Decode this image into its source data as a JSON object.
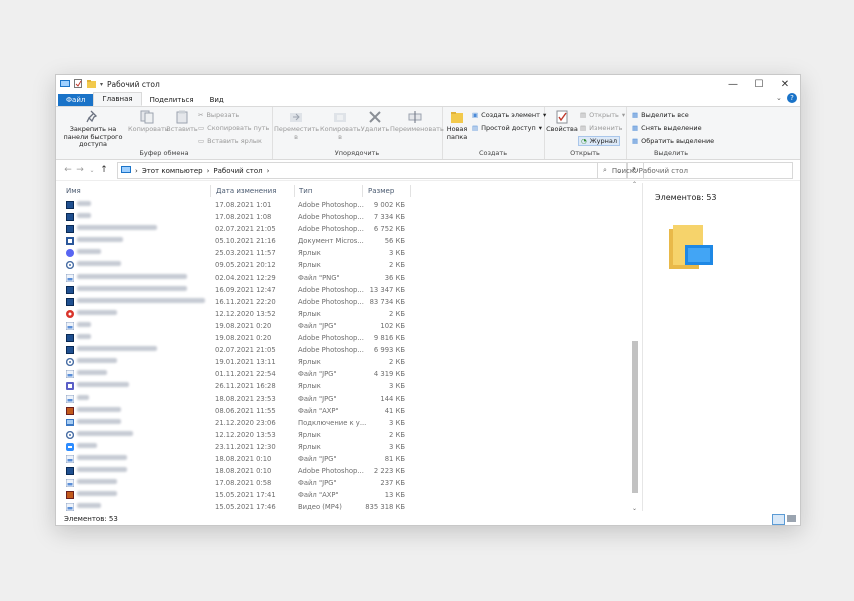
{
  "window": {
    "title": "Рабочий стол",
    "controls": {
      "minimize": "—",
      "maximize": "☐",
      "close": "✕"
    }
  },
  "tabs": [
    "Файл",
    "Главная",
    "Поделиться",
    "Вид"
  ],
  "ribbon": {
    "clipboard": {
      "pin": "Закрепить на панели быстрого доступа",
      "copy": "Копировать",
      "paste": "Вставить",
      "cut": "Вырезать",
      "copy_path": "Скопировать путь",
      "paste_shortcut": "Вставить ярлык",
      "group": "Буфер обмена"
    },
    "organize": {
      "move": "Переместить в",
      "copy_to": "Копировать в",
      "delete": "Удалить",
      "rename": "Переименовать",
      "group": "Упорядочить"
    },
    "new": {
      "folder": "Новая папка",
      "new_item": "Создать элемент",
      "easy_access": "Простой доступ",
      "group": "Создать"
    },
    "open": {
      "properties": "Свойства",
      "open": "Открыть",
      "edit": "Изменить",
      "history": "Журнал",
      "group": "Открыть"
    },
    "select": {
      "select_all": "Выделить все",
      "select_none": "Снять выделение",
      "invert": "Обратить выделение",
      "group": "Выделить"
    }
  },
  "address": {
    "crumbs": [
      "Этот компьютер",
      "Рабочий стол"
    ],
    "search_placeholder": "Поиск: Рабочий стол"
  },
  "columns": {
    "name": "Имя",
    "date": "Дата изменения",
    "type": "Тип",
    "size": "Размер"
  },
  "files": [
    {
      "date": "17.08.2021 1:01",
      "type": "Adobe Photoshop...",
      "size": "9 002 КБ",
      "icon": "ps",
      "w": 14
    },
    {
      "date": "17.08.2021 1:08",
      "type": "Adobe Photoshop...",
      "size": "7 334 КБ",
      "icon": "ps",
      "w": 14
    },
    {
      "date": "02.07.2021 21:05",
      "type": "Adobe Photoshop...",
      "size": "6 752 КБ",
      "icon": "ps",
      "w": 80
    },
    {
      "date": "05.10.2021 21:16",
      "type": "Документ Micros...",
      "size": "56 КБ",
      "icon": "word",
      "w": 46
    },
    {
      "date": "25.03.2021 11:57",
      "type": "Ярлык",
      "size": "3 КБ",
      "icon": "discord",
      "w": 24
    },
    {
      "date": "09.05.2021 20:12",
      "type": "Ярлык",
      "size": "2 КБ",
      "icon": "gear",
      "w": 44
    },
    {
      "date": "02.04.2021 12:29",
      "type": "Файл \"PNG\"",
      "size": "36 КБ",
      "icon": "img",
      "w": 110
    },
    {
      "date": "16.09.2021 12:47",
      "type": "Adobe Photoshop...",
      "size": "13 347 КБ",
      "icon": "ps",
      "w": 110
    },
    {
      "date": "16.11.2021 22:20",
      "type": "Adobe Photoshop...",
      "size": "83 734 КБ",
      "icon": "ps",
      "w": 128
    },
    {
      "date": "12.12.2020 13:52",
      "type": "Ярлык",
      "size": "2 КБ",
      "icon": "red",
      "w": 40
    },
    {
      "date": "19.08.2021 0:20",
      "type": "Файл \"JPG\"",
      "size": "102 КБ",
      "icon": "img",
      "w": 14
    },
    {
      "date": "19.08.2021 0:20",
      "type": "Adobe Photoshop...",
      "size": "9 816 КБ",
      "icon": "ps",
      "w": 14
    },
    {
      "date": "02.07.2021 21:05",
      "type": "Adobe Photoshop...",
      "size": "6 993 КБ",
      "icon": "ps",
      "w": 80
    },
    {
      "date": "19.01.2021 13:11",
      "type": "Ярлык",
      "size": "2 КБ",
      "icon": "gear",
      "w": 40
    },
    {
      "date": "01.11.2021 22:54",
      "type": "Файл \"JPG\"",
      "size": "4 319 КБ",
      "icon": "img",
      "w": 30
    },
    {
      "date": "26.11.2021 16:28",
      "type": "Ярлык",
      "size": "3 КБ",
      "icon": "teams",
      "w": 52
    },
    {
      "date": "18.08.2021 23:53",
      "type": "Файл \"JPG\"",
      "size": "144 КБ",
      "icon": "img",
      "w": 12
    },
    {
      "date": "08.06.2021 11:55",
      "type": "Файл \"AXP\"",
      "size": "41 КБ",
      "icon": "axp",
      "w": 44
    },
    {
      "date": "21.12.2020 23:06",
      "type": "Подключение к у...",
      "size": "3 КБ",
      "icon": "rdp",
      "w": 44
    },
    {
      "date": "12.12.2020 13:53",
      "type": "Ярлык",
      "size": "2 КБ",
      "icon": "gear",
      "w": 56
    },
    {
      "date": "23.11.2021 12:30",
      "type": "Ярлык",
      "size": "3 КБ",
      "icon": "zoom",
      "w": 20
    },
    {
      "date": "18.08.2021 0:10",
      "type": "Файл \"JPG\"",
      "size": "81 КБ",
      "icon": "img",
      "w": 50
    },
    {
      "date": "18.08.2021 0:10",
      "type": "Adobe Photoshop...",
      "size": "2 223 КБ",
      "icon": "ps",
      "w": 50
    },
    {
      "date": "17.08.2021 0:58",
      "type": "Файл \"JPG\"",
      "size": "237 КБ",
      "icon": "img",
      "w": 40
    },
    {
      "date": "15.05.2021 17:41",
      "type": "Файл \"AXP\"",
      "size": "13 КБ",
      "icon": "axp",
      "w": 40
    },
    {
      "date": "15.05.2021 17:46",
      "type": "Видео (MP4)",
      "size": "835 318 КБ",
      "icon": "img",
      "w": 24
    }
  ],
  "preview": {
    "count_text": "Элементов: 53"
  },
  "status": {
    "count_text": "Элементов: 53"
  },
  "colors": {
    "accent": "#1a73c8",
    "ps": "#0a2a55",
    "folder": "#f2c94c"
  }
}
